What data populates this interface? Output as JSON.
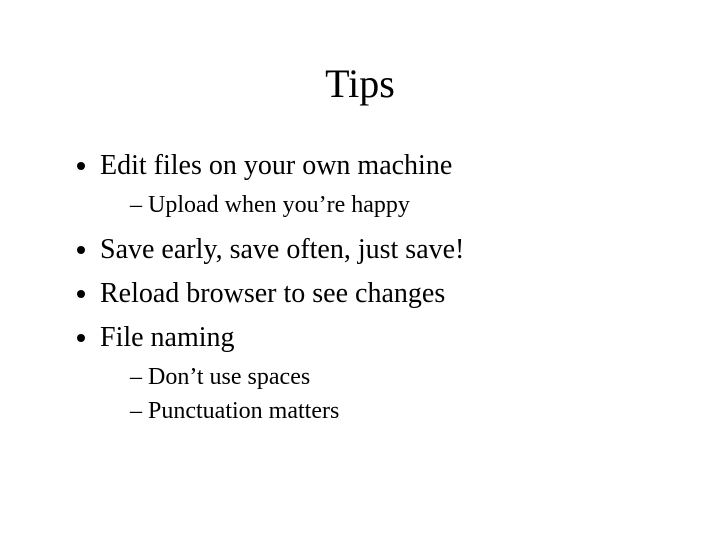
{
  "title": "Tips",
  "bullets": {
    "b1": "Edit files on your own machine",
    "b1_sub1": "Upload when you’re happy",
    "b2": "Save early, save often, just save!",
    "b3": "Reload browser to see changes",
    "b4": "File naming",
    "b4_sub1": "Don’t use spaces",
    "b4_sub2": "Punctuation matters"
  }
}
